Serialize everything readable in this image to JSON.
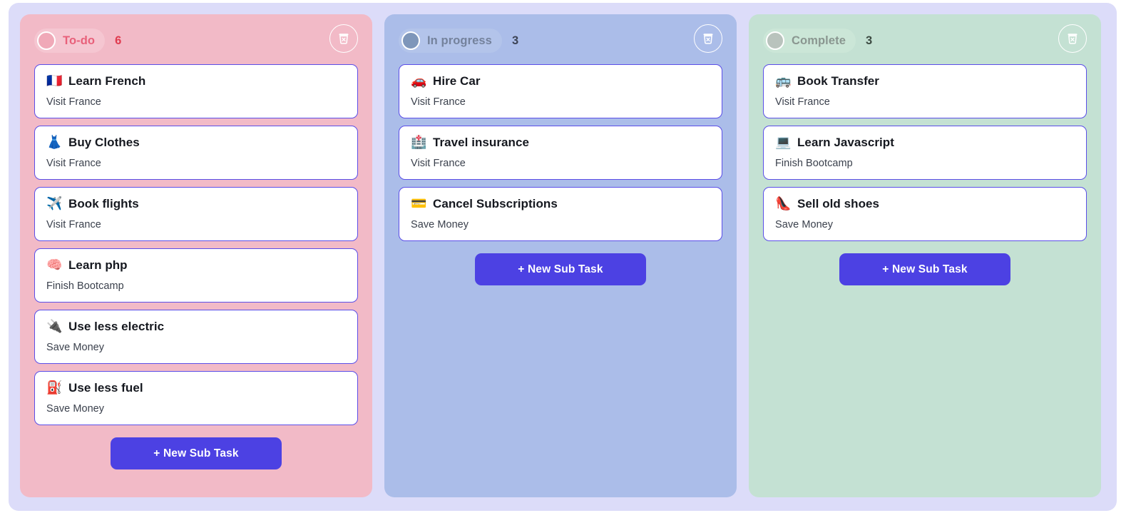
{
  "board": {
    "columns": [
      {
        "id": "todo",
        "status_label": "To-do",
        "count": "6",
        "delete_icon": "trash-x-icon",
        "status_icon": "status-dot-todo",
        "new_task_label": "+ New Sub Task",
        "tasks": [
          {
            "emoji": "🇫🇷",
            "emoji_name": "flag-france-icon",
            "title": "Learn French",
            "subtitle": "Visit France"
          },
          {
            "emoji": "👗",
            "emoji_name": "dress-icon",
            "title": "Buy Clothes",
            "subtitle": "Visit France"
          },
          {
            "emoji": "✈️",
            "emoji_name": "airplane-icon",
            "title": "Book flights",
            "subtitle": "Visit France"
          },
          {
            "emoji": "🧠",
            "emoji_name": "brain-icon",
            "title": "Learn php",
            "subtitle": "Finish Bootcamp"
          },
          {
            "emoji": "🔌",
            "emoji_name": "electric-plug-icon",
            "title": "Use less electric",
            "subtitle": "Save Money"
          },
          {
            "emoji": "⛽",
            "emoji_name": "fuel-pump-icon",
            "title": "Use less fuel",
            "subtitle": "Save Money"
          }
        ]
      },
      {
        "id": "progress",
        "status_label": "In progress",
        "count": "3",
        "delete_icon": "trash-x-icon",
        "status_icon": "status-dot-progress",
        "new_task_label": "+ New Sub Task",
        "tasks": [
          {
            "emoji": "🚗",
            "emoji_name": "car-icon",
            "title": "Hire Car",
            "subtitle": "Visit France"
          },
          {
            "emoji": "🏥",
            "emoji_name": "hospital-icon",
            "title": "Travel insurance",
            "subtitle": "Visit France"
          },
          {
            "emoji": "💳",
            "emoji_name": "credit-card-icon",
            "title": "Cancel Subscriptions",
            "subtitle": "Save Money"
          }
        ]
      },
      {
        "id": "complete",
        "status_label": "Complete",
        "count": "3",
        "delete_icon": "trash-x-icon",
        "status_icon": "status-dot-complete",
        "new_task_label": "+ New Sub Task",
        "tasks": [
          {
            "emoji": "🚌",
            "emoji_name": "bus-icon",
            "title": "Book Transfer",
            "subtitle": "Visit France"
          },
          {
            "emoji": "💻",
            "emoji_name": "laptop-icon",
            "title": "Learn Javascript",
            "subtitle": "Finish Bootcamp"
          },
          {
            "emoji": "👠",
            "emoji_name": "high-heel-icon",
            "title": "Sell old shoes",
            "subtitle": "Save Money"
          }
        ]
      }
    ]
  },
  "colors": {
    "page_background": "#dcdcf9",
    "column_todo": "#f2bac7",
    "column_progress": "#abbde9",
    "column_complete": "#c4e1d3",
    "card_border": "#5b4ee8",
    "card_background": "#ffffff",
    "button_primary": "#4c41e3",
    "button_text": "#ffffff",
    "todo_label": "#e8607a",
    "todo_count": "#e03b4f",
    "progress_label": "#74829c",
    "complete_label": "#8a9690",
    "task_title": "#15181f",
    "task_subtitle": "#3a404c"
  }
}
